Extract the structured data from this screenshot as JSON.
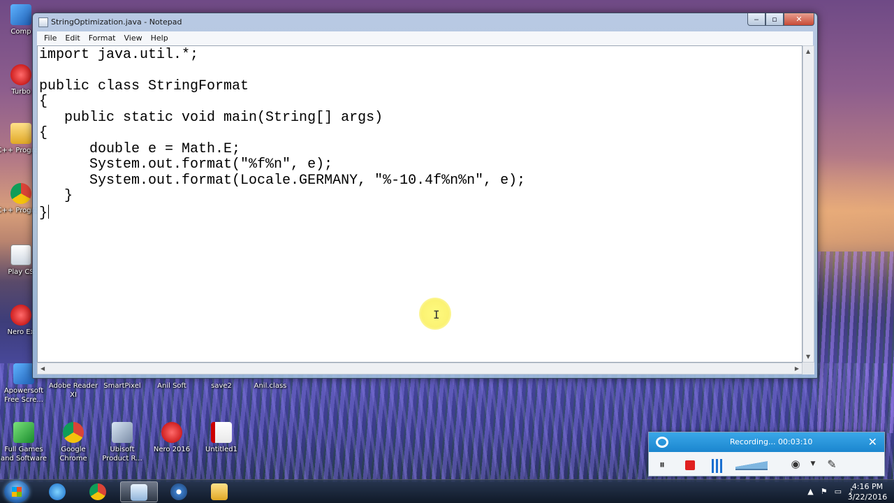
{
  "desktop": {
    "icons_left": [
      {
        "label": "Comp",
        "icon": "computer-icon"
      },
      {
        "label": "Turbo",
        "icon": "turbo-icon"
      },
      {
        "label": "C++ Program",
        "icon": "folder-icon"
      },
      {
        "label": "C++ Program",
        "icon": "chrome-icon"
      },
      {
        "label": "Play CS",
        "icon": "shortcut-icon"
      },
      {
        "label": "Nero Ex",
        "icon": "nero-icon"
      }
    ],
    "icons_row1": [
      {
        "label": "Apowersoft Free Scre...",
        "icon": "apowersoft-icon"
      },
      {
        "label": "Adobe Reader XI",
        "icon": "pdf-icon"
      },
      {
        "label": "SmartPixel",
        "icon": "smartpixel-icon"
      },
      {
        "label": "Anil Soft",
        "icon": "app-icon"
      },
      {
        "label": "save2",
        "icon": "file-icon"
      },
      {
        "label": "Anil.class",
        "icon": "file-icon"
      }
    ],
    "icons_row2": [
      {
        "label": "Full Games and Software",
        "icon": "games-icon"
      },
      {
        "label": "Google Chrome",
        "icon": "chrome-icon"
      },
      {
        "label": "Ubisoft Product R...",
        "icon": "ubisoft-icon"
      },
      {
        "label": "Nero 2016",
        "icon": "nero-icon"
      },
      {
        "label": "Untitled1",
        "icon": "document-icon"
      }
    ]
  },
  "notepad": {
    "title": "StringOptimization.java - Notepad",
    "buttons": {
      "minimize": "‒",
      "maximize": "▫",
      "close": "✕"
    },
    "menu": [
      "File",
      "Edit",
      "Format",
      "View",
      "Help"
    ],
    "code_lines": [
      "import java.util.*;",
      "",
      "public class StringFormat",
      "{",
      "   public static void main(String[] args)",
      "{",
      "      double e = Math.E;",
      "      System.out.format(\"%f%n\", e);",
      "      System.out.format(Locale.GERMANY, \"%-10.4f%n%n\", e);",
      "   }",
      "}"
    ]
  },
  "recorder": {
    "status": "Recording... 00:03:10",
    "close": "✕",
    "pause_glyph": "⏸",
    "camera_glyph": "◉",
    "dropdown_glyph": "▼",
    "pen_glyph": "✎"
  },
  "taskbar": {
    "apps": [
      {
        "name": "internet-explorer",
        "icon": "ie-icon"
      },
      {
        "name": "chrome",
        "icon": "chrome-icon"
      },
      {
        "name": "notepad",
        "icon": "notepad-icon",
        "active": true
      },
      {
        "name": "arc",
        "icon": "arc-icon"
      },
      {
        "name": "explorer",
        "icon": "folder-icon"
      }
    ],
    "tray_glyphs": [
      "▲",
      "⚑",
      "▭",
      "♪"
    ],
    "time": "4:16 PM",
    "date": "3/22/2016"
  }
}
